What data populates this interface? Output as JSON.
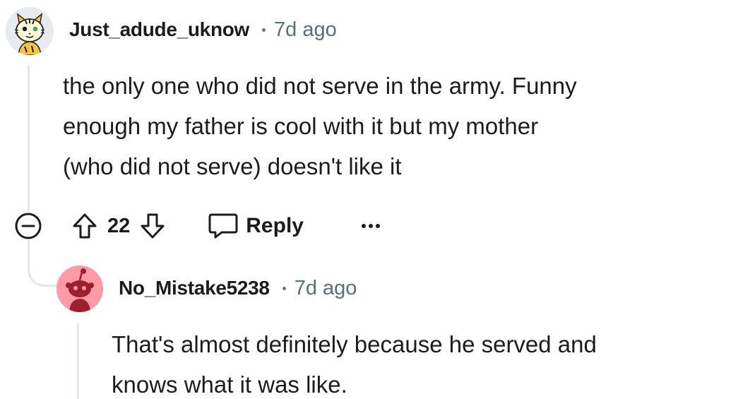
{
  "comment": {
    "username": "Just_adude_uknow",
    "avatar_icon": "tiger-avatar-icon",
    "time": "7d ago",
    "lines": [
      "the only one who did not serve in the army. Funny",
      "enough my father is cool with it but my mother",
      "(who did not serve) doesn't like it"
    ],
    "actions": {
      "collapse_icon": "minus-circle-icon",
      "upvote_icon": "arrow-up-icon",
      "score": "22",
      "downvote_icon": "arrow-down-icon",
      "reply_icon": "speech-bubble-icon",
      "reply_label": "Reply",
      "more_icon": "ellipsis-icon"
    }
  },
  "reply": {
    "username": "No_Mistake5238",
    "avatar_icon": "snoo-avatar-icon",
    "avatar_color": "#ff9aa6",
    "time": "7d ago",
    "lines": [
      "That's almost definitely because he served and",
      "knows what it was like."
    ]
  }
}
